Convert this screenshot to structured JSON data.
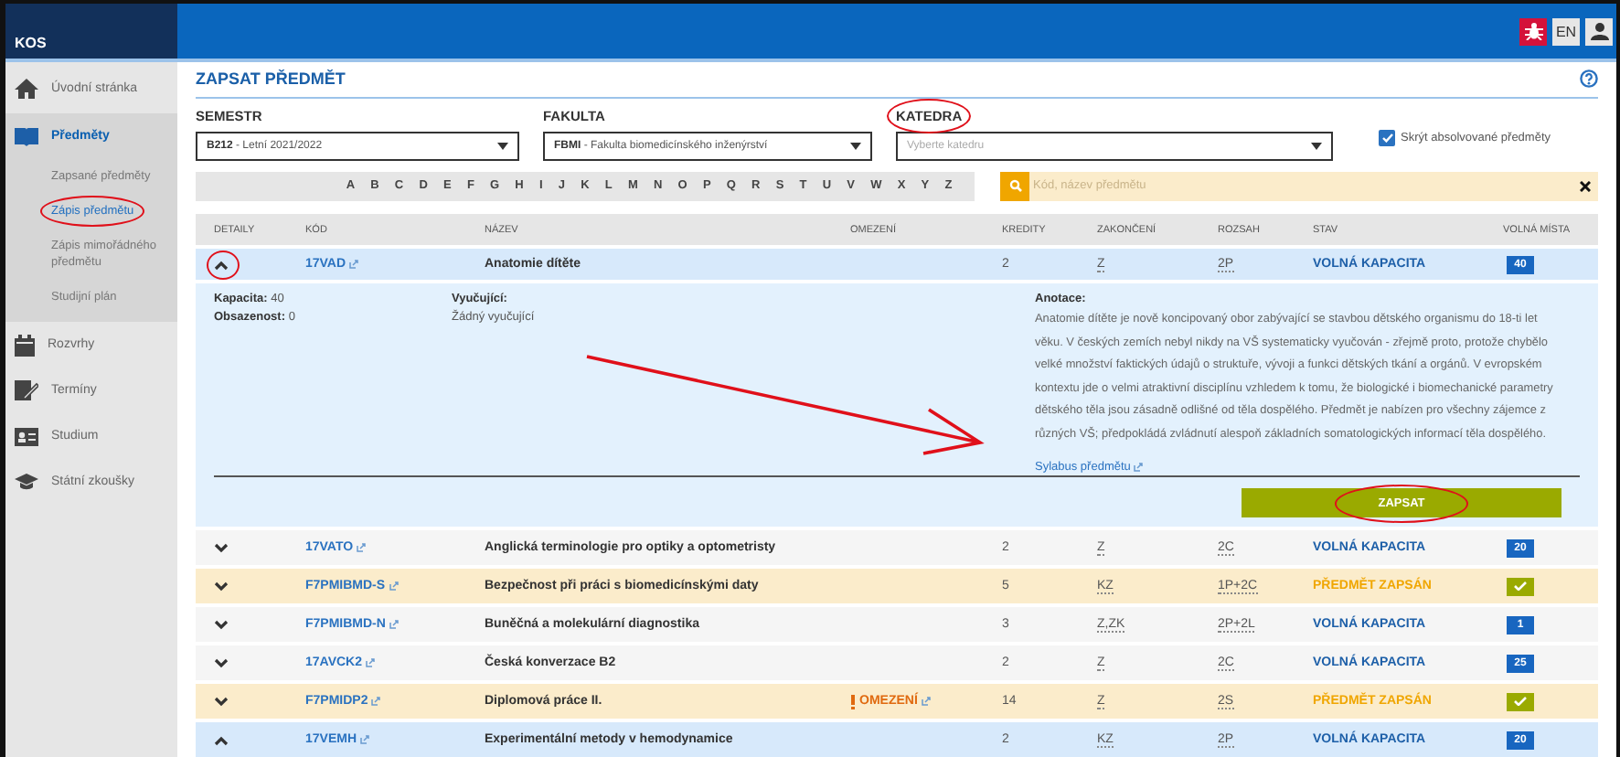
{
  "header": {
    "logo": "KOS",
    "language": "EN"
  },
  "sidebar": {
    "items": [
      {
        "label": "Úvodní stránka",
        "selected": false
      },
      {
        "label": "Předměty",
        "selected": true,
        "children": [
          {
            "label": "Zapsané předměty",
            "selected": false
          },
          {
            "label": "Zápis předmětu",
            "selected": true
          },
          {
            "label": "Zápis mimořádného předmětu",
            "selected": false
          },
          {
            "label": "Studijní plán",
            "selected": false
          }
        ]
      },
      {
        "label": "Rozvrhy",
        "selected": false
      },
      {
        "label": "Termíny",
        "selected": false
      },
      {
        "label": "Studium",
        "selected": false
      },
      {
        "label": "Státní zkoušky",
        "selected": false
      }
    ]
  },
  "page": {
    "title": "ZAPSAT PŘEDMĚT",
    "filters": [
      {
        "label": "SEMESTR",
        "code": "B212",
        "value": "- Letní 2021/2022"
      },
      {
        "label": "FAKULTA",
        "code": "FBMI",
        "value": "- Fakulta biomedicínského inženýrství"
      },
      {
        "label": "KATEDRA",
        "placeholder": "Vyberte katedru"
      }
    ],
    "hide_completed": {
      "label": "Skrýt absolvované předměty",
      "checked": true
    },
    "letters": [
      "A",
      "B",
      "C",
      "D",
      "E",
      "F",
      "G",
      "H",
      "I",
      "J",
      "K",
      "L",
      "M",
      "N",
      "O",
      "P",
      "Q",
      "R",
      "S",
      "T",
      "U",
      "V",
      "W",
      "X",
      "Y",
      "Z"
    ],
    "search": {
      "placeholder": "Kód, název předmětu"
    }
  },
  "table": {
    "columns": [
      "DETAILY",
      "KÓD",
      "NÁZEV",
      "OMEZENÍ",
      "KREDITY",
      "ZAKONČENÍ",
      "ROZSAH",
      "STAV",
      "VOLNÁ MÍSTA"
    ],
    "rows": [
      {
        "expanded": true,
        "code": "17VAD",
        "name": "Anatomie dítěte",
        "credits": "2",
        "completion": "Z",
        "range": "2P",
        "status": "VOLNÁ KAPACITA",
        "enrolled": false,
        "places": {
          "kind": "count",
          "text": "40"
        },
        "details": {
          "facts": [
            {
              "label": "Kapacita:",
              "value": "40"
            },
            {
              "label": "Obsazenost:",
              "value": "0"
            }
          ],
          "teachers_label": "Vyučující:",
          "teachers": "Žádný vyučující",
          "annotation_label": "Anotace:",
          "annotation": "Anatomie dítěte je nově koncipovaný obor zabývající se stavbou dětského organismu do 18-ti let věku. V českých zemích nebyl nikdy na VŠ systematicky vyučován - zřejmě proto, protože chybělo velké množství faktických údajů o struktuře, vývoji a funkci dětských tkání a orgánů. V evropském kontextu jde o velmi atraktivní disciplínu vzhledem k tomu, že biologické i biomechanické parametry dětského těla jsou zásadně odlišné od těla dospělého. Předmět je nabízen pro všechny zájemce z různých VŠ; předpokládá zvládnutí alespoň základních somatologických informací těla dospělého.",
          "syllabus": "Sylabus předmětu",
          "enroll": "ZAPSAT"
        }
      },
      {
        "expanded": false,
        "code": "17VATO",
        "name": "Anglická terminologie pro optiky a optometristy",
        "credits": "2",
        "completion": "Z",
        "range": "2C",
        "status": "VOLNÁ KAPACITA",
        "enrolled": false,
        "places": {
          "kind": "count",
          "text": "20"
        }
      },
      {
        "expanded": false,
        "code": "F7PMIBMD-S",
        "name": "Bezpečnost při práci s biomedicínskými daty",
        "credits": "5",
        "completion": "KZ",
        "range": "1P+2C",
        "status": "PŘEDMĚT ZAPSÁN",
        "enrolled": true,
        "places": {
          "kind": "check"
        }
      },
      {
        "expanded": false,
        "code": "F7PMIBMD-N",
        "name": "Buněčná a molekulární diagnostika",
        "credits": "3",
        "completion": "Z,ZK",
        "range": "2P+2L",
        "status": "VOLNÁ KAPACITA",
        "enrolled": false,
        "places": {
          "kind": "count",
          "text": "1"
        }
      },
      {
        "expanded": false,
        "code": "17AVCK2",
        "name": "Česká konverzace B2",
        "credits": "2",
        "completion": "Z",
        "range": "2C",
        "status": "VOLNÁ KAPACITA",
        "enrolled": false,
        "places": {
          "kind": "count",
          "text": "25"
        }
      },
      {
        "expanded": false,
        "code": "F7PMIDP2",
        "name": "Diplomová práce II.",
        "restriction": "OMEZENÍ",
        "credits": "14",
        "completion": "Z",
        "range": "2S",
        "status": "PŘEDMĚT ZAPSÁN",
        "enrolled": true,
        "places": {
          "kind": "check"
        }
      },
      {
        "expanded": true,
        "code": "17VEMH",
        "name": "Experimentální metody v hemodynamice",
        "credits": "2",
        "completion": "KZ",
        "range": "2P",
        "status": "VOLNÁ KAPACITA",
        "enrolled": false,
        "places": {
          "kind": "count",
          "text": "20"
        }
      }
    ]
  }
}
